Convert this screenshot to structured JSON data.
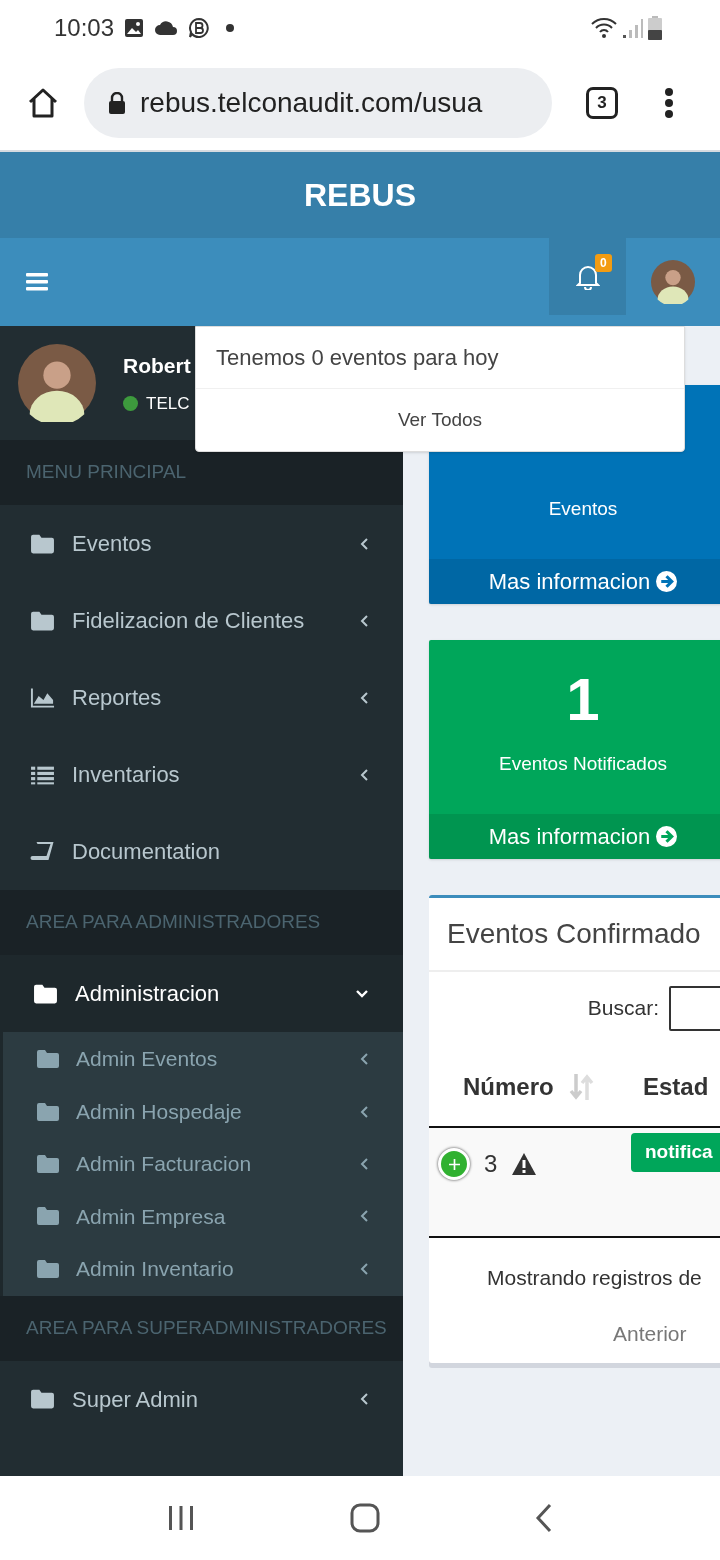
{
  "status_bar": {
    "time": "10:03"
  },
  "browser": {
    "url": "rebus.telconaudit.com/usua",
    "tab_count": "3"
  },
  "header": {
    "title": "REBUS"
  },
  "navbar": {
    "notification_count": "0"
  },
  "notifications_dropdown": {
    "message": "Tenemos 0 eventos para hoy",
    "footer_link": "Ver Todos"
  },
  "user_panel": {
    "name": "Robert",
    "status": "TELC"
  },
  "sidebar": {
    "sections": [
      {
        "header": "MENU PRINCIPAL",
        "items": [
          {
            "label": "Eventos",
            "kind": "folder",
            "expanded": false
          },
          {
            "label": "Fidelizacion de Clientes",
            "kind": "folder",
            "expanded": false
          },
          {
            "label": "Reportes",
            "kind": "chart",
            "expanded": false
          },
          {
            "label": "Inventarios",
            "kind": "list",
            "expanded": false
          },
          {
            "label": "Documentation",
            "kind": "book"
          }
        ]
      },
      {
        "header": "AREA PARA ADMINISTRADORES",
        "items": [
          {
            "label": "Administracion",
            "kind": "folder",
            "expanded": true,
            "children": [
              {
                "label": "Admin Eventos",
                "expanded": false
              },
              {
                "label": "Admin Hospedaje",
                "expanded": false
              },
              {
                "label": "Admin Facturacion",
                "expanded": false
              },
              {
                "label": "Admin Empresa",
                "expanded": false
              },
              {
                "label": "Admin Inventario",
                "expanded": false
              }
            ]
          }
        ]
      },
      {
        "header": "AREA PARA SUPERADMINISTRADORES",
        "items": [
          {
            "label": "Super Admin",
            "kind": "folder",
            "expanded": false
          }
        ]
      }
    ]
  },
  "info_boxes": [
    {
      "label": "Eventos",
      "link": "Mas informacion",
      "color": "#0073b7"
    },
    {
      "value": "1",
      "label": "Eventos Notificados",
      "link": "Mas informacion",
      "color": "#00a65a"
    }
  ],
  "table_box": {
    "title": "Eventos Confirmado",
    "search_label": "Buscar:",
    "columns": [
      {
        "label": "Número",
        "sortable": true
      },
      {
        "label": "Estad",
        "sortable": false
      }
    ],
    "rows": [
      {
        "number": "3",
        "warning": true,
        "status": "notifica"
      }
    ],
    "info": "Mostrando registros de",
    "pagination": [
      "Anterior"
    ]
  }
}
